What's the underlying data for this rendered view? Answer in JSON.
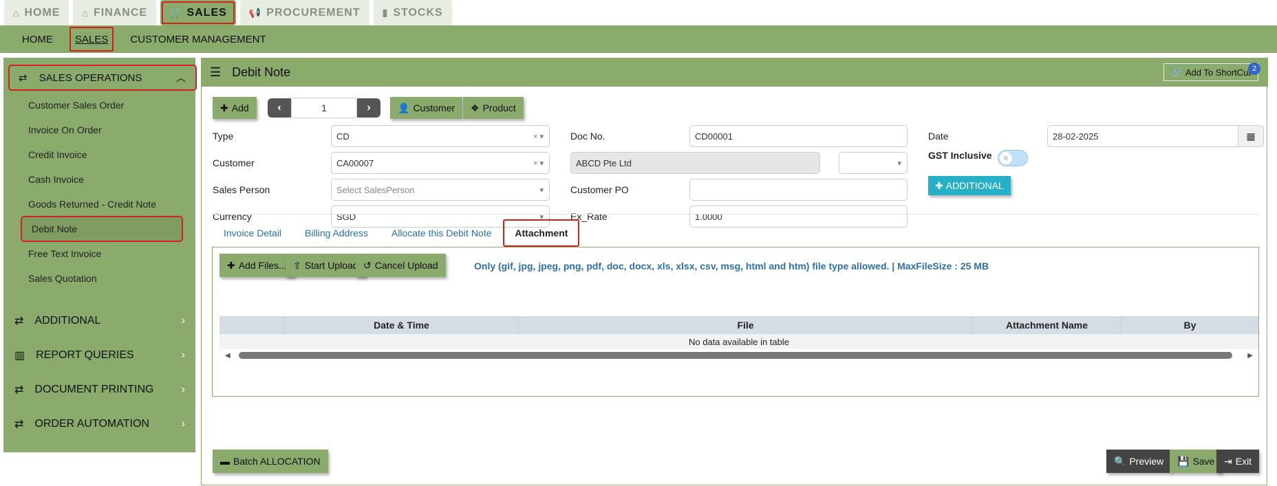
{
  "top_nav": [
    {
      "label": "HOME",
      "icon": "home-icon"
    },
    {
      "label": "FINANCE",
      "icon": "bank-icon"
    },
    {
      "label": "SALES",
      "icon": "cart-icon"
    },
    {
      "label": "PROCUREMENT",
      "icon": "megaphone-icon"
    },
    {
      "label": "STOCKS",
      "icon": "bar-chart-icon"
    }
  ],
  "sub_nav": {
    "home": "HOME",
    "sales": "SALES",
    "customer_mgmt": "CUSTOMER MANAGEMENT"
  },
  "sidebar": {
    "section": "SALES OPERATIONS",
    "items": [
      "Customer Sales Order",
      "Invoice On Order",
      "Credit Invoice",
      "Cash Invoice",
      "Goods Returned - Credit Note",
      "Debit Note",
      "Free Text Invoice",
      "Sales Quotation"
    ],
    "groups": [
      "ADDITIONAL",
      "REPORT QUERIES",
      "DOCUMENT PRINTING",
      "ORDER AUTOMATION"
    ]
  },
  "page": {
    "title": "Debit Note",
    "shortcut_label": "Add To ShortCut",
    "shortcut_count": "2"
  },
  "toolbar": {
    "add": "Add",
    "page_number": "1",
    "customer": "Customer",
    "product": "Product"
  },
  "form": {
    "type_label": "Type",
    "type_value": "CD",
    "customer_label": "Customer",
    "customer_value": "CA00007",
    "sales_person_label": "Sales Person",
    "sales_person_placeholder": "Select SalesPerson",
    "currency_label": "Currency",
    "currency_value": "SGD",
    "doc_no_label": "Doc No.",
    "doc_no_value": "CD00001",
    "customer_name_value": "ABCD Pte Ltd",
    "customer_po_label": "Customer PO",
    "customer_po_value": "",
    "ex_rate_label": "Ex_Rate",
    "ex_rate_value": "1.0000",
    "date_label": "Date",
    "date_value": "28-02-2025",
    "gst_label": "GST Inclusive",
    "additional_button": "ADDITIONAL"
  },
  "tabs": [
    "Invoice Detail",
    "Billing Address",
    "Allocate this Debit Note",
    "Attachment"
  ],
  "attachment": {
    "add_files": "Add Files...",
    "start_upload": "Start Upload",
    "cancel_upload": "Cancel Upload",
    "note": "Only (gif, jpg, jpeg, png, pdf, doc, docx, xls, xlsx, csv, msg, html and htm) file type allowed. | MaxFileSize : 25 MB",
    "columns": [
      "",
      "Date & Time",
      "File",
      "Attachment Name",
      "By"
    ],
    "empty_message": "No data available in table"
  },
  "footer": {
    "batch_allocation": "Batch ALLOCATION",
    "preview": "Preview",
    "save": "Save",
    "exit": "Exit"
  },
  "colors": {
    "accent_green": "#8aab6c",
    "highlight_red": "#d62020",
    "info_blue": "#26b0c8",
    "link_blue": "#2e6fa8"
  }
}
